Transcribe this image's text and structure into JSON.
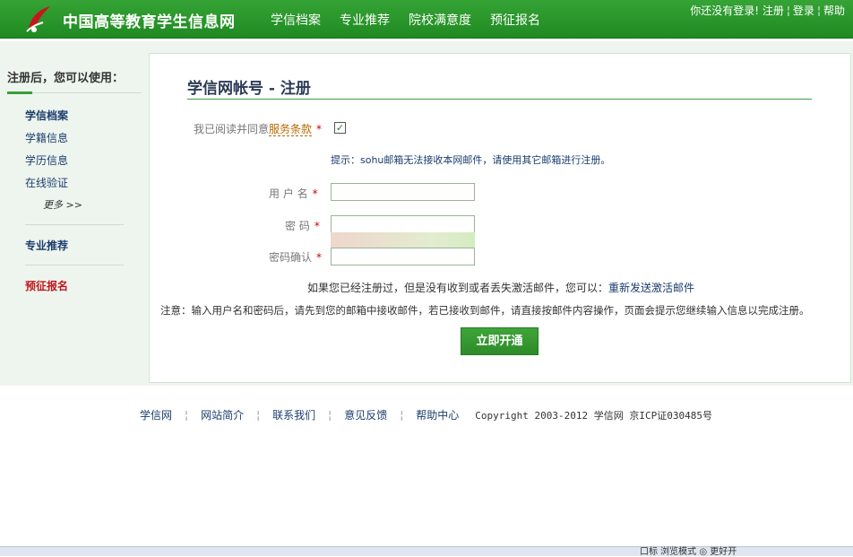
{
  "header": {
    "site_title": "中国高等教育学生信息网",
    "nav": [
      "学信档案",
      "专业推荐",
      "院校满意度",
      "预征报名"
    ],
    "top_links": {
      "status": "你还没有登录!",
      "register": "注册",
      "login": "登录",
      "help": "帮助"
    },
    "brand_color": "#2a9a2d"
  },
  "sidebar": {
    "title": "注册后，您可以使用：",
    "items": [
      "学信档案",
      "学籍信息",
      "学历信息",
      "在线验证"
    ],
    "more": "更多 >>",
    "recommend": "专业推荐",
    "enlist": "预征报名"
  },
  "form": {
    "title": "学信网帐号 - 注册",
    "agree_prefix": "我已阅读并同意",
    "terms_link": "服务条款",
    "required_mark": "*",
    "agree_checked": true,
    "tip": "提示：sohu邮箱无法接收本网邮件，请使用其它邮箱进行注册。",
    "username_label": "用 户 名",
    "password_label": "密  码",
    "password_confirm_label": "密码确认",
    "username_value": "",
    "password_value": "",
    "password_confirm_value": "",
    "resend_prefix": "如果您已经注册过，但是没有收到或者丢失激活邮件，您可以：",
    "resend_link": "重新发送激活邮件",
    "notice": "注意：输入用户名和密码后，请先到您的邮箱中接收邮件，若已接收到邮件，请直接按邮件内容操作，页面会提示您继续输入信息以完成注册。",
    "submit_label": "立即开通"
  },
  "footer": {
    "links": [
      "学信网",
      "网站简介",
      "联系我们",
      "意见反馈",
      "帮助中心"
    ],
    "copyright": "Copyright 2003-2012 学信网 京ICP证030485号"
  },
  "statusbar": {
    "text": "口标 浏览模式  ◎ 更好开"
  }
}
